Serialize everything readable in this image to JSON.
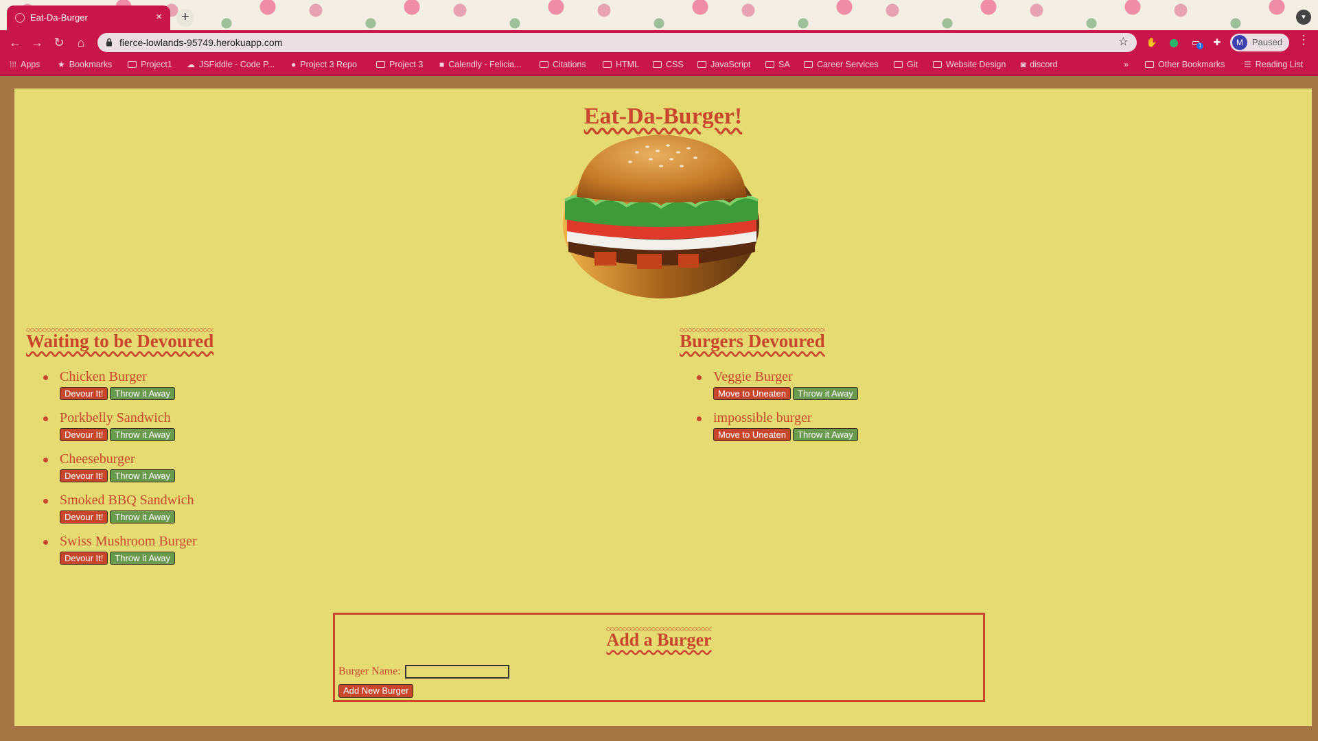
{
  "browser": {
    "tab_title": "Eat-Da-Burger",
    "tab_close": "×",
    "new_tab": "+",
    "url": "fierce-lowlands-95749.herokuapp.com",
    "profile_initial": "M",
    "profile_status": "Paused",
    "extension_badge": "1",
    "bookmarks": [
      "Apps",
      "Bookmarks",
      "Project1",
      "JSFiddle - Code P...",
      "Project 3 Repo",
      "Project 3",
      "Calendly - Felicia...",
      "Citations",
      "HTML",
      "CSS",
      "JavaScript",
      "SA",
      "Career Services",
      "Git",
      "Website Design",
      "discord"
    ],
    "bookmarks_overflow": "»",
    "other_bookmarks": "Other Bookmarks",
    "reading_list": "Reading List"
  },
  "page": {
    "title": "Eat-Da-Burger!",
    "waiting_title": "Waiting to be Devoured",
    "devoured_title": "Burgers Devoured",
    "waiting": [
      "Chicken Burger",
      "Porkbelly Sandwich",
      "Cheeseburger",
      "Smoked BBQ Sandwich",
      "Swiss Mushroom Burger"
    ],
    "devoured": [
      "Veggie Burger",
      "impossible burger"
    ],
    "devour_label": "Devour It!",
    "throw_label": "Throw it Away",
    "uneaten_label": "Move to Uneaten",
    "add_title": "Add a Burger",
    "burger_name_label": "Burger Name:",
    "burger_name_value": "",
    "add_button": "Add New Burger"
  },
  "colors": {
    "accent": "#c8472c",
    "panel": "#e6da72",
    "frame": "#a57543",
    "chrome": "#c8154a",
    "green_button": "#6a9a4d"
  }
}
